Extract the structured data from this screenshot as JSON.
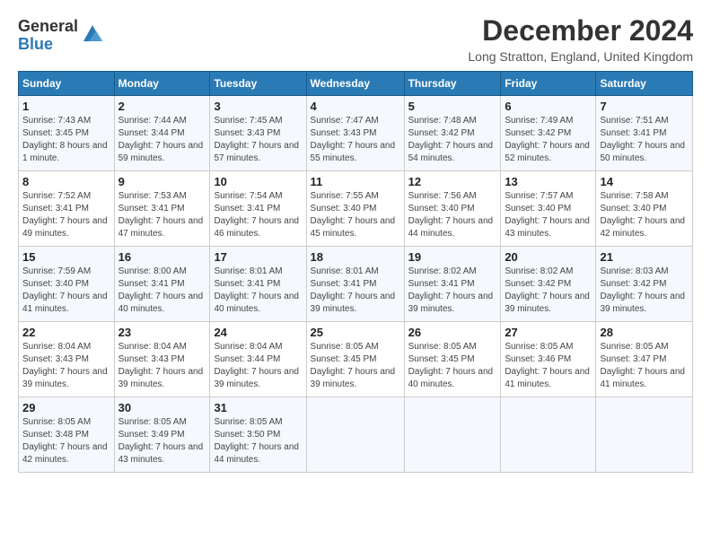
{
  "logo": {
    "general": "General",
    "blue": "Blue"
  },
  "title": "December 2024",
  "location": "Long Stratton, England, United Kingdom",
  "days_header": [
    "Sunday",
    "Monday",
    "Tuesday",
    "Wednesday",
    "Thursday",
    "Friday",
    "Saturday"
  ],
  "weeks": [
    [
      {
        "num": "1",
        "info": "Sunrise: 7:43 AM\nSunset: 3:45 PM\nDaylight: 8 hours and 1 minute."
      },
      {
        "num": "2",
        "info": "Sunrise: 7:44 AM\nSunset: 3:44 PM\nDaylight: 7 hours and 59 minutes."
      },
      {
        "num": "3",
        "info": "Sunrise: 7:45 AM\nSunset: 3:43 PM\nDaylight: 7 hours and 57 minutes."
      },
      {
        "num": "4",
        "info": "Sunrise: 7:47 AM\nSunset: 3:43 PM\nDaylight: 7 hours and 55 minutes."
      },
      {
        "num": "5",
        "info": "Sunrise: 7:48 AM\nSunset: 3:42 PM\nDaylight: 7 hours and 54 minutes."
      },
      {
        "num": "6",
        "info": "Sunrise: 7:49 AM\nSunset: 3:42 PM\nDaylight: 7 hours and 52 minutes."
      },
      {
        "num": "7",
        "info": "Sunrise: 7:51 AM\nSunset: 3:41 PM\nDaylight: 7 hours and 50 minutes."
      }
    ],
    [
      {
        "num": "8",
        "info": "Sunrise: 7:52 AM\nSunset: 3:41 PM\nDaylight: 7 hours and 49 minutes."
      },
      {
        "num": "9",
        "info": "Sunrise: 7:53 AM\nSunset: 3:41 PM\nDaylight: 7 hours and 47 minutes."
      },
      {
        "num": "10",
        "info": "Sunrise: 7:54 AM\nSunset: 3:41 PM\nDaylight: 7 hours and 46 minutes."
      },
      {
        "num": "11",
        "info": "Sunrise: 7:55 AM\nSunset: 3:40 PM\nDaylight: 7 hours and 45 minutes."
      },
      {
        "num": "12",
        "info": "Sunrise: 7:56 AM\nSunset: 3:40 PM\nDaylight: 7 hours and 44 minutes."
      },
      {
        "num": "13",
        "info": "Sunrise: 7:57 AM\nSunset: 3:40 PM\nDaylight: 7 hours and 43 minutes."
      },
      {
        "num": "14",
        "info": "Sunrise: 7:58 AM\nSunset: 3:40 PM\nDaylight: 7 hours and 42 minutes."
      }
    ],
    [
      {
        "num": "15",
        "info": "Sunrise: 7:59 AM\nSunset: 3:40 PM\nDaylight: 7 hours and 41 minutes."
      },
      {
        "num": "16",
        "info": "Sunrise: 8:00 AM\nSunset: 3:41 PM\nDaylight: 7 hours and 40 minutes."
      },
      {
        "num": "17",
        "info": "Sunrise: 8:01 AM\nSunset: 3:41 PM\nDaylight: 7 hours and 40 minutes."
      },
      {
        "num": "18",
        "info": "Sunrise: 8:01 AM\nSunset: 3:41 PM\nDaylight: 7 hours and 39 minutes."
      },
      {
        "num": "19",
        "info": "Sunrise: 8:02 AM\nSunset: 3:41 PM\nDaylight: 7 hours and 39 minutes."
      },
      {
        "num": "20",
        "info": "Sunrise: 8:02 AM\nSunset: 3:42 PM\nDaylight: 7 hours and 39 minutes."
      },
      {
        "num": "21",
        "info": "Sunrise: 8:03 AM\nSunset: 3:42 PM\nDaylight: 7 hours and 39 minutes."
      }
    ],
    [
      {
        "num": "22",
        "info": "Sunrise: 8:04 AM\nSunset: 3:43 PM\nDaylight: 7 hours and 39 minutes."
      },
      {
        "num": "23",
        "info": "Sunrise: 8:04 AM\nSunset: 3:43 PM\nDaylight: 7 hours and 39 minutes."
      },
      {
        "num": "24",
        "info": "Sunrise: 8:04 AM\nSunset: 3:44 PM\nDaylight: 7 hours and 39 minutes."
      },
      {
        "num": "25",
        "info": "Sunrise: 8:05 AM\nSunset: 3:45 PM\nDaylight: 7 hours and 39 minutes."
      },
      {
        "num": "26",
        "info": "Sunrise: 8:05 AM\nSunset: 3:45 PM\nDaylight: 7 hours and 40 minutes."
      },
      {
        "num": "27",
        "info": "Sunrise: 8:05 AM\nSunset: 3:46 PM\nDaylight: 7 hours and 41 minutes."
      },
      {
        "num": "28",
        "info": "Sunrise: 8:05 AM\nSunset: 3:47 PM\nDaylight: 7 hours and 41 minutes."
      }
    ],
    [
      {
        "num": "29",
        "info": "Sunrise: 8:05 AM\nSunset: 3:48 PM\nDaylight: 7 hours and 42 minutes."
      },
      {
        "num": "30",
        "info": "Sunrise: 8:05 AM\nSunset: 3:49 PM\nDaylight: 7 hours and 43 minutes."
      },
      {
        "num": "31",
        "info": "Sunrise: 8:05 AM\nSunset: 3:50 PM\nDaylight: 7 hours and 44 minutes."
      },
      null,
      null,
      null,
      null
    ]
  ]
}
